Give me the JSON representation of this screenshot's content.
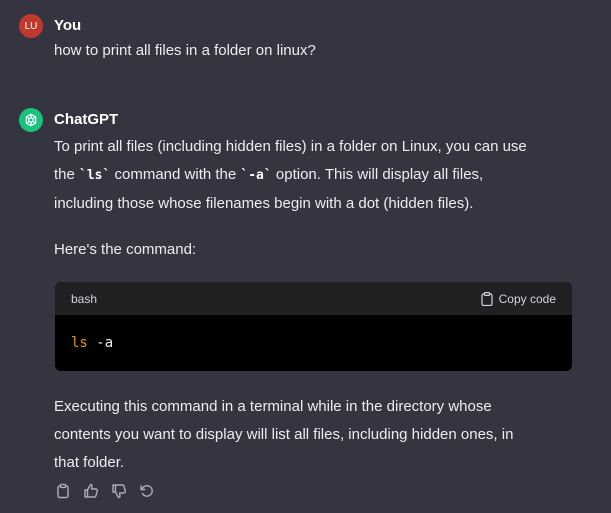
{
  "user_message": {
    "avatar_initials": "LU",
    "name": "You",
    "text": "how to print all files in a folder on linux?"
  },
  "assistant_message": {
    "name": "ChatGPT",
    "para1": {
      "line1": "To print all files (including hidden files) in a folder on Linux, you can use",
      "line2_prefix": "the ",
      "code1": "`ls`",
      "line2_mid": " command with the ",
      "code2": "`-a`",
      "line2_suffix": " option. This will display all files,",
      "line3": "including those whose filenames begin with a dot (hidden files)."
    },
    "para2": "Here's the command:",
    "code_block": {
      "language": "bash",
      "copy_label": "Copy code",
      "cmd": "ls",
      "args": " -a"
    },
    "para3": {
      "line1": "Executing this command in a terminal while in the directory whose",
      "line2": "contents you want to display will list all files, including hidden ones, in",
      "line3": "that folder."
    },
    "actions": [
      "copy-icon",
      "thumbs-up-icon",
      "thumbs-down-icon",
      "regenerate-icon"
    ]
  },
  "colors": {
    "background": "#343541",
    "user_avatar": "#c0392b",
    "assistant_avatar": "#19c37d",
    "code_keyword": "#e9950c"
  }
}
